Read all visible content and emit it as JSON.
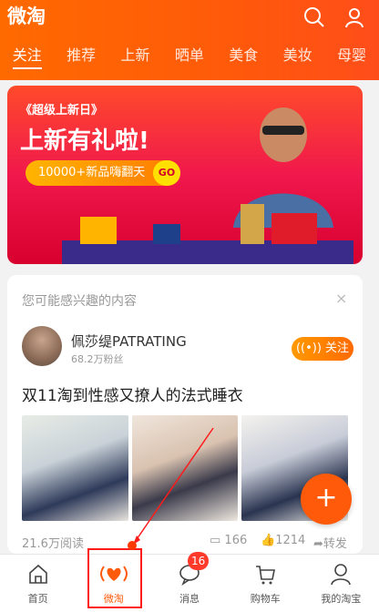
{
  "header": {
    "title": "微淘",
    "tabs": [
      "关注",
      "推荐",
      "上新",
      "晒单",
      "美食",
      "美妆",
      "母婴"
    ],
    "active_tab": 0
  },
  "banner": {
    "tag": "《超级上新日》",
    "headline": "上新有礼啦!",
    "promo": "10000+新品嗨翻天",
    "go": "GO"
  },
  "card": {
    "hint": "您可能感兴趣的内容",
    "close": "×",
    "shop_name": "佩莎缇PATRATING",
    "fans": "68.2万粉丝",
    "follow_label": "关注",
    "post_title": "双11淘到性感又撩人的法式睡衣",
    "reads": "21.6万阅读",
    "comments": "166",
    "likes": "1214",
    "share": "转发"
  },
  "fab_label": "+",
  "tabbar": {
    "items": [
      "首页",
      "微淘",
      "消息",
      "购物车",
      "我的淘宝"
    ],
    "badge": "16"
  },
  "accent": "#ff5a0a"
}
